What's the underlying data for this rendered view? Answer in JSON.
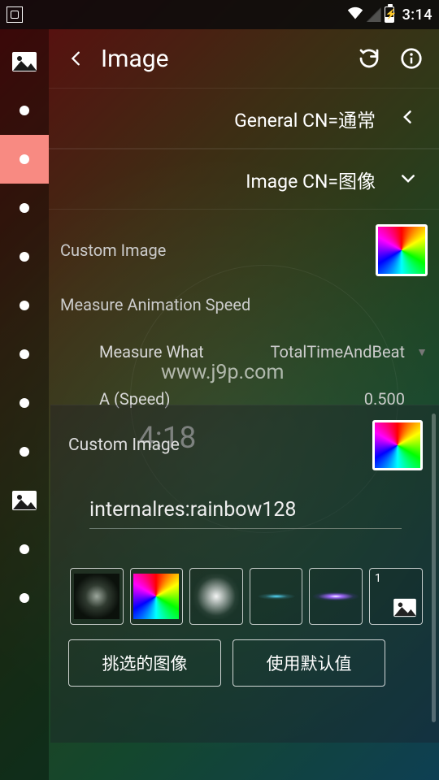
{
  "statusbar": {
    "clock": "3:14"
  },
  "toolbar": {
    "title": "Image"
  },
  "groups": {
    "general": "General  CN=通常",
    "image": "Image  CN=图像"
  },
  "settings": {
    "custom_image_label": "Custom Image",
    "measure_anim_speed_label": "Measure Animation Speed",
    "measure_what_label": "Measure What",
    "measure_what_value": "TotalTimeAndBeat",
    "a_speed_label": "A (Speed)",
    "a_speed_value": "0.500"
  },
  "background": {
    "watermark": "www.j9p.com",
    "big_time": "4:18"
  },
  "panel": {
    "title": "Custom Image",
    "input_value": "internalres:rainbow128",
    "thumbs_picker_badge": "1",
    "btn_pick": "挑选的图像",
    "btn_default": "使用默认值"
  }
}
